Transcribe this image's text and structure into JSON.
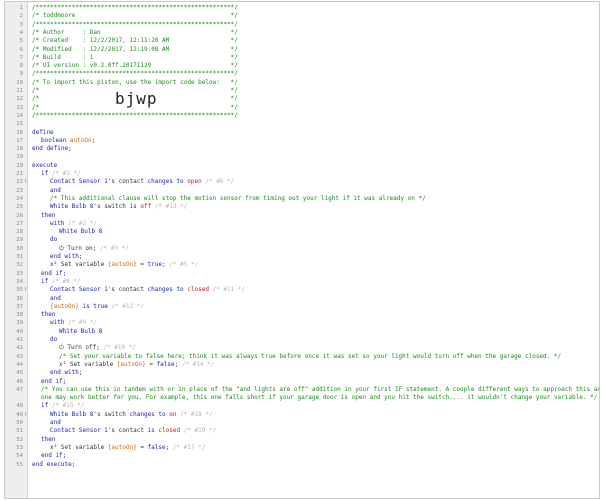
{
  "lines": [
    {
      "n": "1",
      "indent": 0,
      "parts": [
        {
          "t": "/*******************************************************/",
          "c": "c"
        }
      ]
    },
    {
      "n": "2",
      "indent": 0,
      "parts": [
        {
          "t": "/* toddmoore                                           */",
          "c": "c"
        }
      ]
    },
    {
      "n": "3",
      "indent": 0,
      "parts": [
        {
          "t": "/*******************************************************/",
          "c": "c"
        }
      ]
    },
    {
      "n": "4",
      "indent": 0,
      "parts": [
        {
          "t": "/* Author     : Dan                                    */",
          "c": "c"
        }
      ]
    },
    {
      "n": "5",
      "indent": 0,
      "parts": [
        {
          "t": "/* Created    : 12/2/2017, 12:11:26 AM                 */",
          "c": "c"
        }
      ]
    },
    {
      "n": "6",
      "indent": 0,
      "parts": [
        {
          "t": "/* Modified   : 12/2/2017, 12:19:08 AM                 */",
          "c": "c"
        }
      ]
    },
    {
      "n": "7",
      "indent": 0,
      "parts": [
        {
          "t": "/* Build      : 1                                      */",
          "c": "c"
        }
      ]
    },
    {
      "n": "8",
      "indent": 0,
      "parts": [
        {
          "t": "/* UI version : v0.2.0ff.20171129                      */",
          "c": "c"
        }
      ]
    },
    {
      "n": "9",
      "indent": 0,
      "parts": [
        {
          "t": "/*******************************************************/",
          "c": "c"
        }
      ]
    },
    {
      "n": "10",
      "indent": 0,
      "parts": [
        {
          "t": "/* To import this piston, use the import code below:   */",
          "c": "c"
        }
      ]
    },
    {
      "n": "11",
      "indent": 0,
      "parts": [
        {
          "t": "/*                                                     */",
          "c": "c"
        }
      ]
    },
    {
      "n": "12",
      "indent": 0,
      "parts": [
        {
          "t": "/*                                                     */",
          "c": "c"
        }
      ]
    },
    {
      "n": "13",
      "indent": 0,
      "parts": [
        {
          "t": "/*                                                     */",
          "c": "c"
        }
      ]
    },
    {
      "n": "14",
      "indent": 0,
      "parts": [
        {
          "t": "/*******************************************************/",
          "c": "c"
        }
      ]
    },
    {
      "n": "15",
      "indent": 0,
      "parts": []
    },
    {
      "n": "16",
      "indent": 0,
      "parts": [
        {
          "t": "define",
          "c": "k"
        }
      ]
    },
    {
      "n": "17",
      "indent": 2,
      "parts": [
        {
          "t": "boolean ",
          "c": "k"
        },
        {
          "t": "autoOn",
          "c": "v"
        },
        {
          "t": ";",
          "c": "p"
        }
      ]
    },
    {
      "n": "18",
      "indent": 0,
      "parts": [
        {
          "t": "end define;",
          "c": "k"
        }
      ]
    },
    {
      "n": "19",
      "indent": 0,
      "parts": []
    },
    {
      "n": "20",
      "indent": 0,
      "parts": [
        {
          "t": "execute",
          "c": "k"
        }
      ]
    },
    {
      "n": "21",
      "indent": 2,
      "parts": [
        {
          "t": "if ",
          "c": "k"
        },
        {
          "t": "/* #1 */",
          "c": "g"
        }
      ]
    },
    {
      "n": "22",
      "indent": 4,
      "mark": "!",
      "parts": [
        {
          "t": "Contact Sensor 1",
          "c": "d"
        },
        {
          "t": "'s ",
          "c": "p"
        },
        {
          "t": "contact",
          "c": "p"
        },
        {
          "t": " changes to ",
          "c": "k"
        },
        {
          "t": "open",
          "c": "s"
        },
        {
          "t": " /* #6 */",
          "c": "g"
        }
      ]
    },
    {
      "n": "23",
      "indent": 4,
      "parts": [
        {
          "t": "and",
          "c": "k"
        }
      ]
    },
    {
      "n": "24",
      "indent": 4,
      "parts": [
        {
          "t": "/* This additional clause will stop the motion sensor from timing out your light if it was already on */",
          "c": "c"
        }
      ]
    },
    {
      "n": "25",
      "indent": 4,
      "parts": [
        {
          "t": "White Bulb 8",
          "c": "d"
        },
        {
          "t": "'s ",
          "c": "p"
        },
        {
          "t": "switch",
          "c": "p"
        },
        {
          "t": " is ",
          "c": "k"
        },
        {
          "t": "off",
          "c": "s"
        },
        {
          "t": " /* #13 */",
          "c": "g"
        }
      ]
    },
    {
      "n": "26",
      "indent": 2,
      "parts": [
        {
          "t": "then",
          "c": "k"
        }
      ]
    },
    {
      "n": "27",
      "indent": 4,
      "parts": [
        {
          "t": "with ",
          "c": "k"
        },
        {
          "t": "/* #2 */",
          "c": "g"
        }
      ]
    },
    {
      "n": "28",
      "indent": 6,
      "parts": [
        {
          "t": "White Bulb 8",
          "c": "d"
        }
      ]
    },
    {
      "n": "29",
      "indent": 4,
      "parts": [
        {
          "t": "do",
          "c": "k"
        }
      ]
    },
    {
      "n": "30",
      "indent": 6,
      "parts": [
        {
          "t": "⏻ ",
          "c": "p"
        },
        {
          "t": "Turn on;",
          "c": "p"
        },
        {
          "t": " /* #3 */",
          "c": "g"
        }
      ]
    },
    {
      "n": "31",
      "indent": 4,
      "parts": [
        {
          "t": "end with;",
          "c": "k"
        }
      ]
    },
    {
      "n": "32",
      "indent": 4,
      "parts": [
        {
          "t": "x² Set variable ",
          "c": "p"
        },
        {
          "t": "{autoOn}",
          "c": "v"
        },
        {
          "t": " = ",
          "c": "p"
        },
        {
          "t": "true",
          "c": "k"
        },
        {
          "t": ";",
          "c": "p"
        },
        {
          "t": " /* #5 */",
          "c": "g"
        }
      ]
    },
    {
      "n": "33",
      "indent": 2,
      "parts": [
        {
          "t": "end if;",
          "c": "k"
        }
      ]
    },
    {
      "n": "34",
      "indent": 2,
      "parts": [
        {
          "t": "if ",
          "c": "k"
        },
        {
          "t": "/* #8 */",
          "c": "g"
        }
      ]
    },
    {
      "n": "35",
      "indent": 4,
      "mark": "!",
      "parts": [
        {
          "t": "Contact Sensor 1",
          "c": "d"
        },
        {
          "t": "'s ",
          "c": "p"
        },
        {
          "t": "contact",
          "c": "p"
        },
        {
          "t": " changes to ",
          "c": "k"
        },
        {
          "t": "closed",
          "c": "s"
        },
        {
          "t": " /* #11 */",
          "c": "g"
        }
      ]
    },
    {
      "n": "36",
      "indent": 4,
      "parts": [
        {
          "t": "and",
          "c": "k"
        }
      ]
    },
    {
      "n": "37",
      "indent": 4,
      "parts": [
        {
          "t": "{autoOn}",
          "c": "v"
        },
        {
          "t": " is ",
          "c": "k"
        },
        {
          "t": "true",
          "c": "k"
        },
        {
          "t": " /* #12 */",
          "c": "g"
        }
      ]
    },
    {
      "n": "38",
      "indent": 2,
      "parts": [
        {
          "t": "then",
          "c": "k"
        }
      ]
    },
    {
      "n": "39",
      "indent": 4,
      "parts": [
        {
          "t": "with ",
          "c": "k"
        },
        {
          "t": "/* #9 */",
          "c": "g"
        }
      ]
    },
    {
      "n": "40",
      "indent": 6,
      "parts": [
        {
          "t": "White Bulb 8",
          "c": "d"
        }
      ]
    },
    {
      "n": "41",
      "indent": 4,
      "parts": [
        {
          "t": "do",
          "c": "k"
        }
      ]
    },
    {
      "n": "42",
      "indent": 6,
      "parts": [
        {
          "t": "⏻ ",
          "c": "p"
        },
        {
          "t": "Turn off;",
          "c": "p"
        },
        {
          "t": " /* #10 */",
          "c": "g"
        }
      ]
    },
    {
      "n": "43",
      "indent": 6,
      "parts": [
        {
          "t": "/* Set your variable to false here; think it was always true before once it was set so your light would turn off when the garage closed. */",
          "c": "c"
        }
      ]
    },
    {
      "n": "44",
      "indent": 6,
      "parts": [
        {
          "t": "x² Set variable ",
          "c": "p"
        },
        {
          "t": "{autoOn}",
          "c": "v"
        },
        {
          "t": " = ",
          "c": "p"
        },
        {
          "t": "false",
          "c": "k"
        },
        {
          "t": ";",
          "c": "p"
        },
        {
          "t": " /* #14 */",
          "c": "g"
        }
      ]
    },
    {
      "n": "45",
      "indent": 4,
      "parts": [
        {
          "t": "end with;",
          "c": "k"
        }
      ]
    },
    {
      "n": "46",
      "indent": 2,
      "parts": [
        {
          "t": "end if;",
          "c": "k"
        }
      ]
    },
    {
      "n": "47",
      "indent": 2,
      "parts": [
        {
          "t": "/* You can use this in tandem with or in place of the \"and lights are off\" addition in your first IF statement. A couple different ways to approach this and",
          "c": "c"
        }
      ]
    },
    {
      "n": "",
      "indent": 2,
      "parts": [
        {
          "t": "one may work better for you. For example, this one falls short if your garage door is open and you hit the switch.... it wouldn't change your variable. */",
          "c": "c"
        }
      ]
    },
    {
      "n": "48",
      "indent": 2,
      "parts": [
        {
          "t": "if ",
          "c": "k"
        },
        {
          "t": "/* #15 */",
          "c": "g"
        }
      ]
    },
    {
      "n": "49",
      "indent": 4,
      "mark": "!",
      "parts": [
        {
          "t": "White Bulb 8",
          "c": "d"
        },
        {
          "t": "'s ",
          "c": "p"
        },
        {
          "t": "switch",
          "c": "p"
        },
        {
          "t": " changes to ",
          "c": "k"
        },
        {
          "t": "on",
          "c": "s"
        },
        {
          "t": " /* #18 */",
          "c": "g"
        }
      ]
    },
    {
      "n": "50",
      "indent": 4,
      "parts": [
        {
          "t": "and",
          "c": "k"
        }
      ]
    },
    {
      "n": "51",
      "indent": 4,
      "parts": [
        {
          "t": "Contact Sensor 1",
          "c": "d"
        },
        {
          "t": "'s ",
          "c": "p"
        },
        {
          "t": "contact",
          "c": "p"
        },
        {
          "t": " is ",
          "c": "k"
        },
        {
          "t": "closed",
          "c": "s"
        },
        {
          "t": " /* #19 */",
          "c": "g"
        }
      ]
    },
    {
      "n": "52",
      "indent": 2,
      "parts": [
        {
          "t": "then",
          "c": "k"
        }
      ]
    },
    {
      "n": "53",
      "indent": 4,
      "parts": [
        {
          "t": "x² Set variable ",
          "c": "p"
        },
        {
          "t": "{autoOn}",
          "c": "v"
        },
        {
          "t": " = ",
          "c": "p"
        },
        {
          "t": "false",
          "c": "k"
        },
        {
          "t": ";",
          "c": "p"
        },
        {
          "t": " /* #17 */",
          "c": "g"
        }
      ]
    },
    {
      "n": "54",
      "indent": 2,
      "parts": [
        {
          "t": "end if;",
          "c": "k"
        }
      ]
    },
    {
      "n": "55",
      "indent": 0,
      "parts": [
        {
          "t": "end execute;",
          "c": "k"
        }
      ]
    }
  ],
  "import_code": "bjwp",
  "colors": {
    "comment": "#1a8c1a",
    "keyword": "#1c24b8",
    "variable": "#d06a10",
    "value": "#b81c1c",
    "gray": "#b5b5b5",
    "marker": "#e0803a"
  }
}
